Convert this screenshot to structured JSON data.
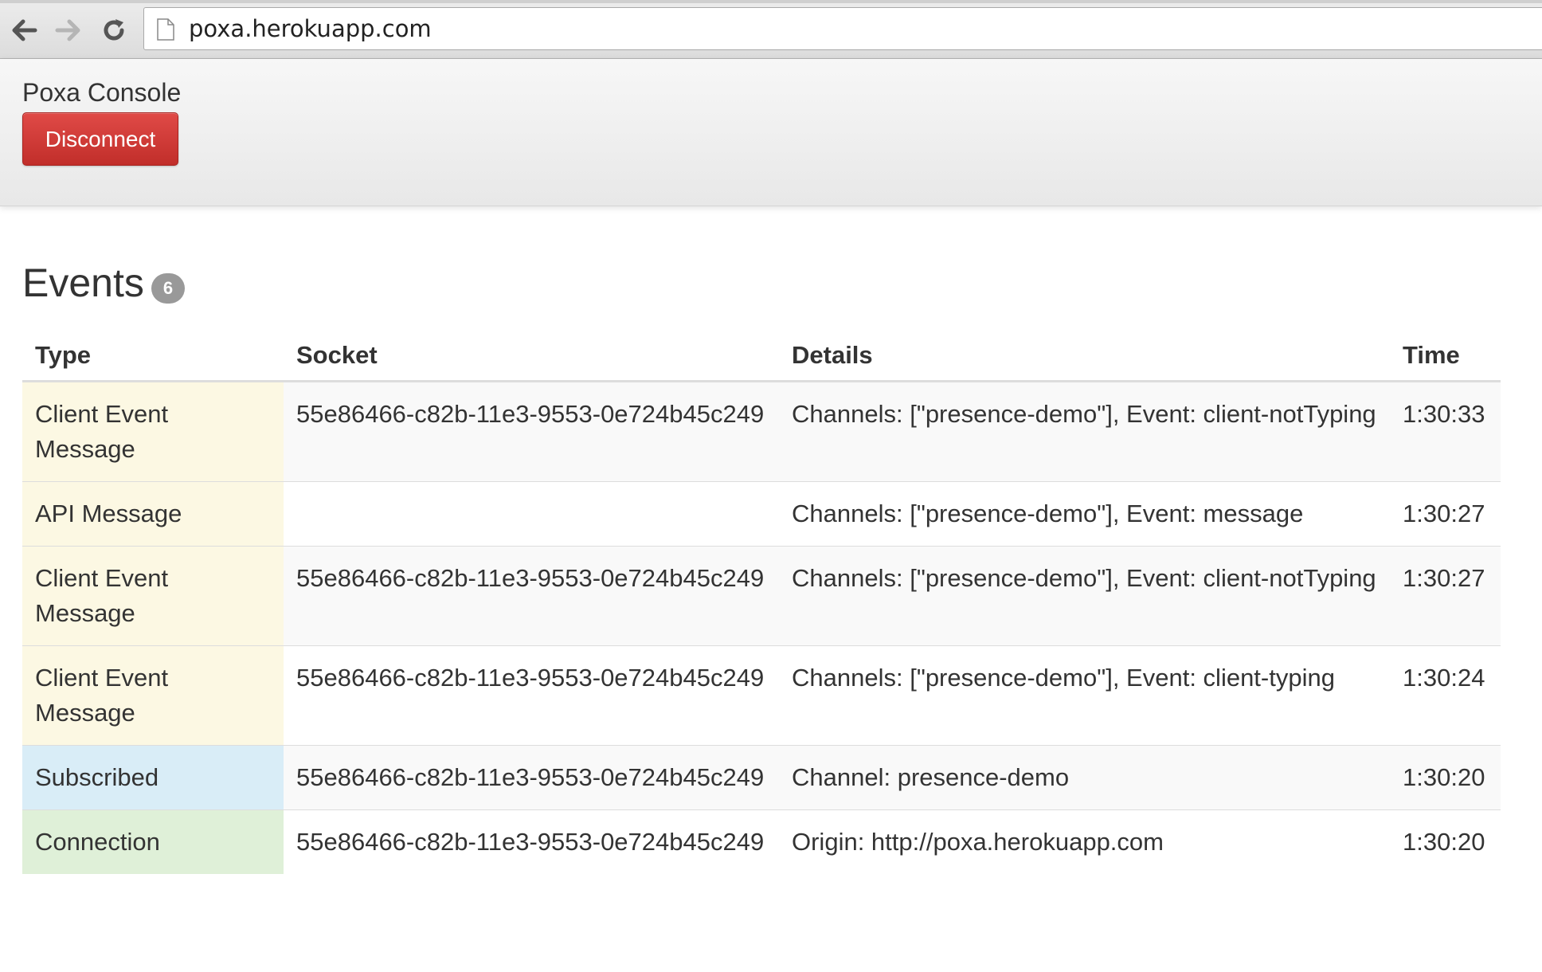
{
  "browser": {
    "url": "poxa.herokuapp.com"
  },
  "navbar": {
    "brand": "Poxa Console",
    "disconnect_label": "Disconnect",
    "disconnect_color": "#d9534f"
  },
  "events": {
    "heading": "Events",
    "count": "6",
    "columns": [
      "Type",
      "Socket",
      "Details",
      "Time"
    ],
    "rows": [
      {
        "type": "Client Event Message",
        "socket": "55e86466-c82b-11e3-9553-0e724b45c249",
        "details": "Channels: [\"presence-demo\"], Event: client-notTyping",
        "time": "1:30:33",
        "status": "warning"
      },
      {
        "type": "API Message",
        "socket": "",
        "details": "Channels: [\"presence-demo\"], Event: message",
        "time": "1:30:27",
        "status": "warning"
      },
      {
        "type": "Client Event Message",
        "socket": "55e86466-c82b-11e3-9553-0e724b45c249",
        "details": "Channels: [\"presence-demo\"], Event: client-notTyping",
        "time": "1:30:27",
        "status": "warning"
      },
      {
        "type": "Client Event Message",
        "socket": "55e86466-c82b-11e3-9553-0e724b45c249",
        "details": "Channels: [\"presence-demo\"], Event: client-typing",
        "time": "1:30:24",
        "status": "warning"
      },
      {
        "type": "Subscribed",
        "socket": "55e86466-c82b-11e3-9553-0e724b45c249",
        "details": "Channel: presence-demo",
        "time": "1:30:20",
        "status": "info"
      },
      {
        "type": "Connection",
        "socket": "55e86466-c82b-11e3-9553-0e724b45c249",
        "details": "Origin: http://poxa.herokuapp.com",
        "time": "1:30:20",
        "status": "success"
      }
    ]
  },
  "colors": {
    "warning": "#fcf8e3",
    "info": "#d9edf7",
    "success": "#dff0d8"
  }
}
